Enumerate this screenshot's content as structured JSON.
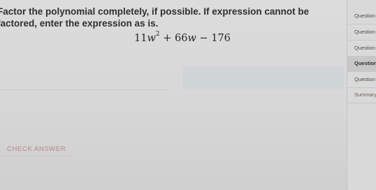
{
  "question": {
    "instructions": "Factor the polynomial completely, if possible. If expression cannot be factored, enter the expression as is.",
    "expression": {
      "coef1": "11",
      "var1": "w",
      "exp1": "2",
      "op1": " + ",
      "coef2": "66",
      "var2": "w",
      "op2": " − ",
      "const": "176"
    }
  },
  "actions": {
    "check_answer_label": "CHECK ANSWER"
  },
  "sidebar": {
    "items": [
      {
        "label": "Question",
        "active": false
      },
      {
        "label": "Question",
        "active": false
      },
      {
        "label": "Question",
        "active": false
      },
      {
        "label": "Question",
        "active": true
      },
      {
        "label": "Question",
        "active": false
      },
      {
        "label": "Summary",
        "active": false
      }
    ]
  }
}
